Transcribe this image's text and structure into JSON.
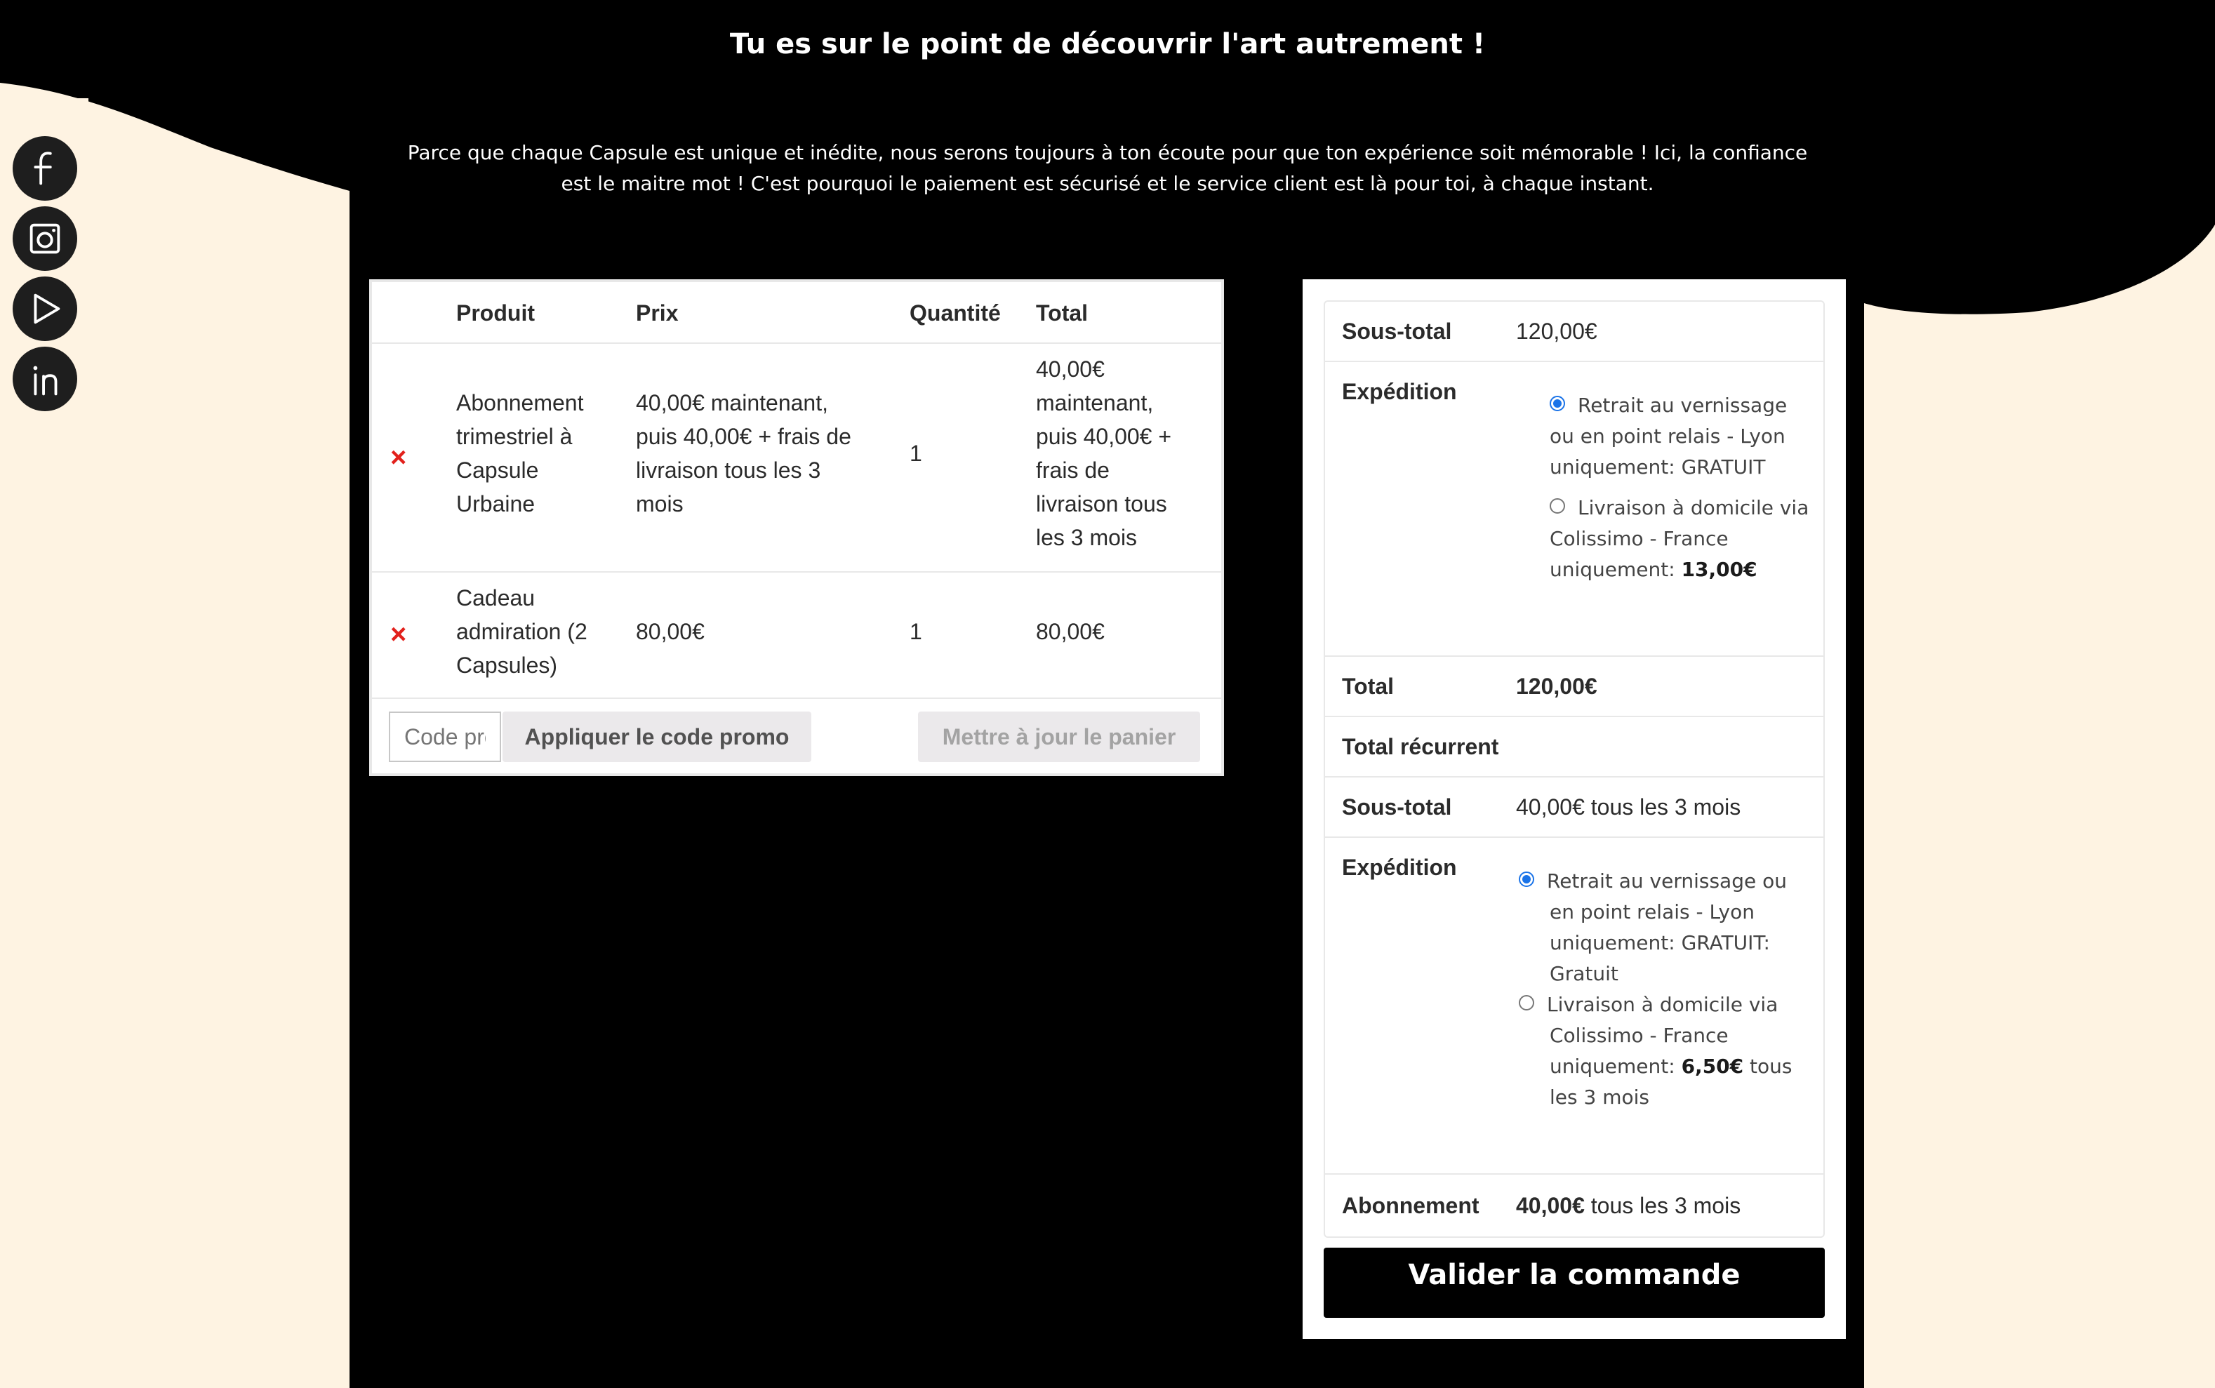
{
  "hero": {
    "title": "Tu es sur le point de découvrir l'art autrement !",
    "text": "Parce que chaque Capsule est unique et inédite, nous serons toujours à ton écoute pour que ton expérience soit mémorable ! Ici, la confiance est le maitre mot ! C'est pourquoi le paiement est sécurisé et le service client est là pour toi, à chaque instant."
  },
  "social": [
    "facebook-icon",
    "instagram-icon",
    "play-icon",
    "linkedin-icon"
  ],
  "cart": {
    "headers": {
      "product": "Produit",
      "price": "Prix",
      "quantity": "Quantité",
      "total": "Total"
    },
    "items": [
      {
        "remove": "×",
        "product_lines": [
          "Abonnement",
          "trimestriel à",
          "Capsule",
          "Urbaine"
        ],
        "price_lines": [
          "40,00€ maintenant,",
          "puis 40,00€ + frais de",
          "livraison tous les 3",
          "mois"
        ],
        "quantity": "1",
        "total_lines": [
          "40,00€",
          "maintenant,",
          "puis 40,00€ +",
          "frais de",
          "livraison tous",
          "les 3 mois"
        ]
      },
      {
        "remove": "×",
        "product_lines": [
          "Cadeau",
          "admiration (2",
          "Capsules)"
        ],
        "price": "80,00€",
        "quantity": "1",
        "total": "80,00€"
      }
    ],
    "coupon_placeholder": "Code promo",
    "apply_coupon": "Appliquer le code promo",
    "update_cart": "Mettre à jour le panier"
  },
  "totals": {
    "subtotal_label": "Sous-total",
    "subtotal": "120,00€",
    "shipping_label": "Expédition",
    "shipping_options": [
      {
        "lines": [
          "Retrait au vernissage",
          "ou en point relais - Lyon",
          "uniquement: GRATUIT"
        ],
        "selected": true
      },
      {
        "lines": [
          "Livraison à domicile via",
          "Colissimo - France",
          "uniquement: "
        ],
        "price": "13,00€",
        "selected": false
      }
    ],
    "total_label": "Total",
    "total": "120,00€",
    "recurring_label": "Total récurrent",
    "rec_subtotal_label": "Sous-total",
    "rec_subtotal": "40,00€ tous les 3 mois",
    "rec_shipping_label": "Expédition",
    "rec_shipping_options": [
      {
        "lines": [
          "Retrait au vernissage ou",
          "en point relais - Lyon",
          "uniquement: GRATUIT:",
          "Gratuit"
        ],
        "selected": true
      },
      {
        "lines": [
          "Livraison à domicile via",
          "Colissimo - France",
          "uniquement: "
        ],
        "price": "6,50€",
        "suffix": " tous",
        "last_line": "les 3 mois",
        "selected": false
      }
    ],
    "subscription_label": "Abonnement",
    "subscription_amount": "40,00€",
    "subscription_suffix": " tous les 3 mois",
    "checkout": "Valider la commande"
  },
  "colors": {
    "background": "#FEF3E2",
    "panel": "#000000",
    "remove": "#E2211C",
    "radio": "#1A73E8"
  }
}
